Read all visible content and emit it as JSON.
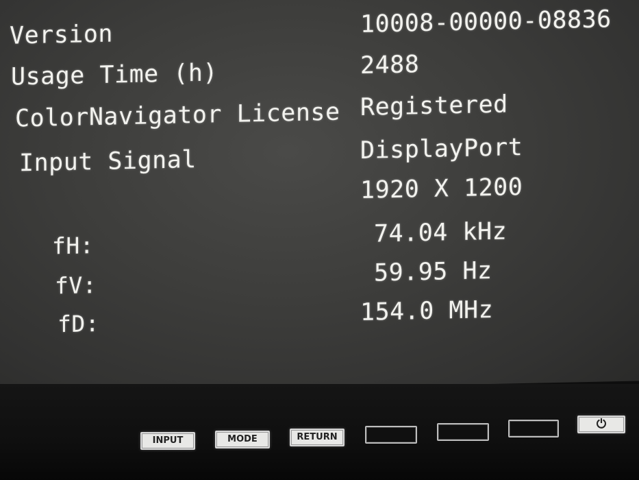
{
  "osd": {
    "version": {
      "label": "Version",
      "value": "10008-00000-08836"
    },
    "usage_time": {
      "label": "Usage Time (h)",
      "value": "2488"
    },
    "colornavigator": {
      "label": "ColorNavigator License",
      "value": "Registered"
    },
    "input_signal": {
      "label": "Input Signal",
      "value": "DisplayPort",
      "resolution": "1920 X 1200"
    },
    "fh": {
      "label": "fH:",
      "value": "74.04 kHz"
    },
    "fv": {
      "label": "fV:",
      "value": "59.95 Hz"
    },
    "fd": {
      "label": "fD:",
      "value": "154.0  MHz"
    }
  },
  "buttons": {
    "input": "INPUT",
    "mode": "MODE",
    "return": "RETURN",
    "power_icon": "power-icon"
  },
  "colors": {
    "osd_background": "#3d3d3b",
    "osd_text": "#f2f2ee",
    "bezel": "#0f0f0f"
  }
}
